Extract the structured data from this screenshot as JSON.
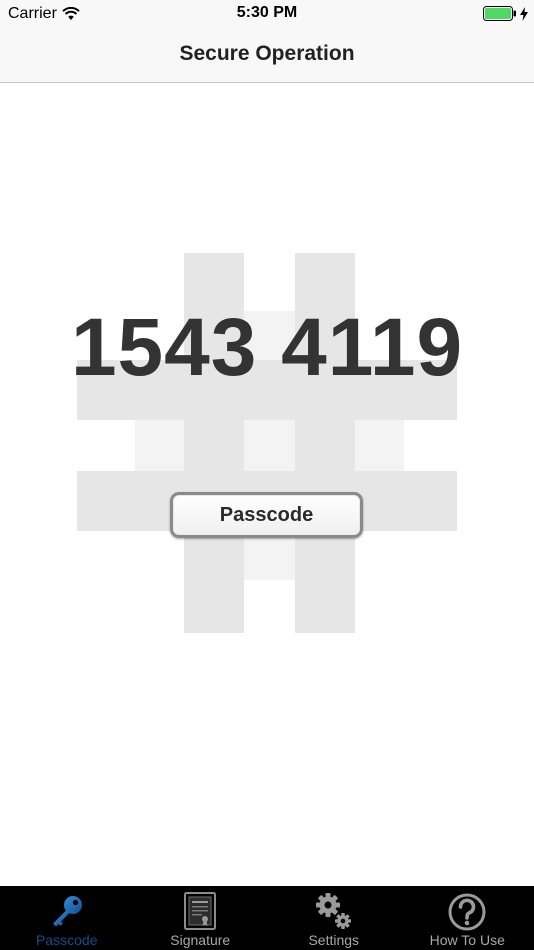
{
  "status_bar": {
    "carrier": "Carrier",
    "time": "5:30 PM",
    "icons": [
      "wifi-icon",
      "battery-icon",
      "charging-bolt-icon"
    ],
    "battery_color": "#4cd964"
  },
  "nav": {
    "title": "Secure Operation"
  },
  "main": {
    "passcode_value": "1543 4119",
    "passcode_button_label": "Passcode",
    "background_icon": "hash-icon",
    "number_color": "#333333"
  },
  "tab_bar": {
    "active_color": "#0d4f8f",
    "tabs": [
      {
        "label": "Passcode",
        "icon": "key-icon",
        "active": true
      },
      {
        "label": "Signature",
        "icon": "certificate-icon",
        "active": false
      },
      {
        "label": "Settings",
        "icon": "gear-icon",
        "active": false
      },
      {
        "label": "How To Use",
        "icon": "question-icon",
        "active": false
      }
    ]
  }
}
